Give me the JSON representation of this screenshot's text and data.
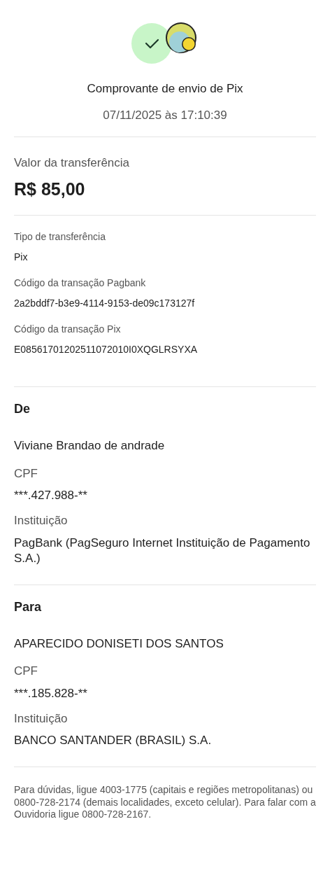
{
  "header": {
    "title": "Comprovante de envio de Pix",
    "datetime": "07/11/2025 às 17:10:39"
  },
  "amount": {
    "label": "Valor da transferência",
    "value": "R$ 85,00"
  },
  "details": [
    {
      "label": "Tipo de transferência",
      "value": "Pix"
    },
    {
      "label": "Código da transação Pagbank",
      "value": "2a2bddf7-b3e9-4114-9153-de09c173127f"
    },
    {
      "label": "Código da transação Pix",
      "value": "E08561701202511072010I0XQGLRSYXA"
    }
  ],
  "parties": [
    {
      "heading": "De",
      "name": "Viviane Brandao de andrade",
      "fields": [
        {
          "label": "CPF",
          "value": "***.427.988-**"
        },
        {
          "label": "Instituição",
          "value": "PagBank (PagSeguro Internet Instituição de Pagamento S.A.)"
        }
      ]
    },
    {
      "heading": "Para",
      "name": "APARECIDO DONISETI DOS SANTOS",
      "fields": [
        {
          "label": "CPF",
          "value": "***.185.828-**"
        },
        {
          "label": "Instituição",
          "value": "BANCO SANTANDER (BRASIL) S.A."
        }
      ]
    }
  ],
  "footer": "Para dúvidas, ligue 4003-1775 (capitais e regiões metropolitanas) ou 0800-728-2174 (demais localidades, exceto celular). Para falar com a Ouvidoria ligue 0800-728-2167."
}
